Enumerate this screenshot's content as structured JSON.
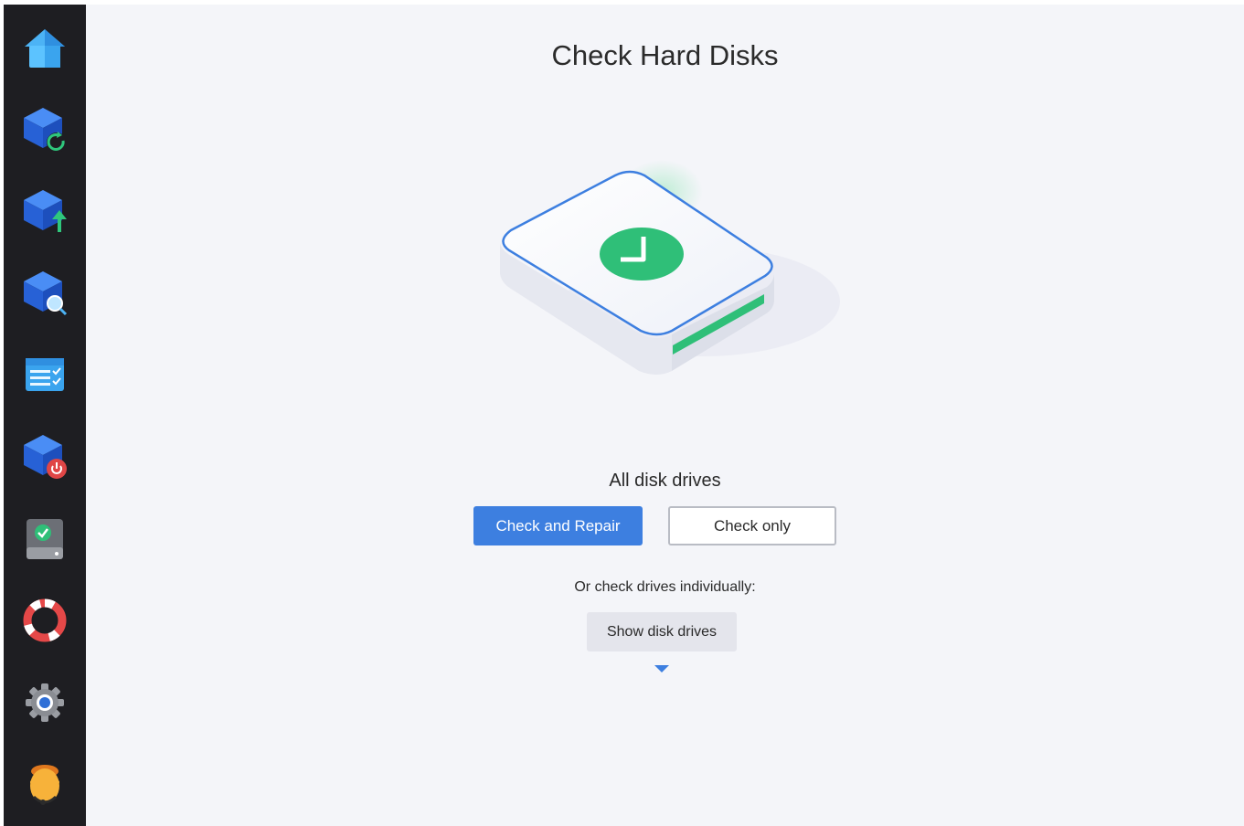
{
  "sidebar": {
    "items": [
      {
        "icon": "home-icon"
      },
      {
        "icon": "backup-refresh-icon"
      },
      {
        "icon": "disk-upload-icon"
      },
      {
        "icon": "disk-search-icon"
      },
      {
        "icon": "checklist-icon"
      },
      {
        "icon": "disk-power-icon"
      },
      {
        "icon": "drive-check-icon"
      },
      {
        "icon": "lifebuoy-icon"
      },
      {
        "icon": "gear-icon"
      },
      {
        "icon": "support-agent-icon"
      }
    ]
  },
  "main": {
    "title": "Check Hard Disks",
    "hero_icon": "hard-disk-check-illustration",
    "all_drives_label": "All disk drives",
    "check_repair_label": "Check and Repair",
    "check_only_label": "Check only",
    "individual_label": "Or check drives individually:",
    "show_drives_label": "Show disk drives"
  },
  "colors": {
    "sidebar_bg": "#1e1e22",
    "main_bg": "#f4f5f9",
    "accent_blue": "#3d7fe0",
    "success_green": "#2fbf78"
  }
}
